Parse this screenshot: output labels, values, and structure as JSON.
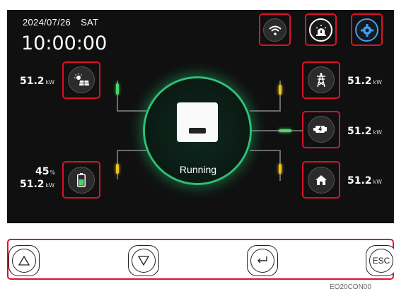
{
  "header": {
    "date": "2024/07/26",
    "day": "SAT",
    "time": "10:00:00"
  },
  "status": {
    "text": "Running"
  },
  "pv": {
    "value": "51.2",
    "unit": "kW"
  },
  "battery": {
    "soc": "45",
    "soc_unit": "%",
    "value": "51.2",
    "unit": "kW"
  },
  "grid": {
    "value": "51.2",
    "unit": "kW"
  },
  "generator": {
    "value": "51.2",
    "unit": "kW"
  },
  "load": {
    "value": "51.2",
    "unit": "kW"
  },
  "buttons": {
    "esc_label": "ESC"
  },
  "footer": {
    "code": "EO20CON00"
  },
  "colors": {
    "highlight": "#e0102a",
    "ring": "#2fbf77",
    "flow_green": "#4cd66b",
    "flow_yellow": "#f0c419",
    "settings_blue": "#3aa0ff"
  },
  "icons": [
    "wifi-icon",
    "alarm-icon",
    "settings-gear-icon",
    "pv-sun-panel-icon",
    "battery-icon",
    "grid-tower-icon",
    "generator-icon",
    "home-icon"
  ]
}
